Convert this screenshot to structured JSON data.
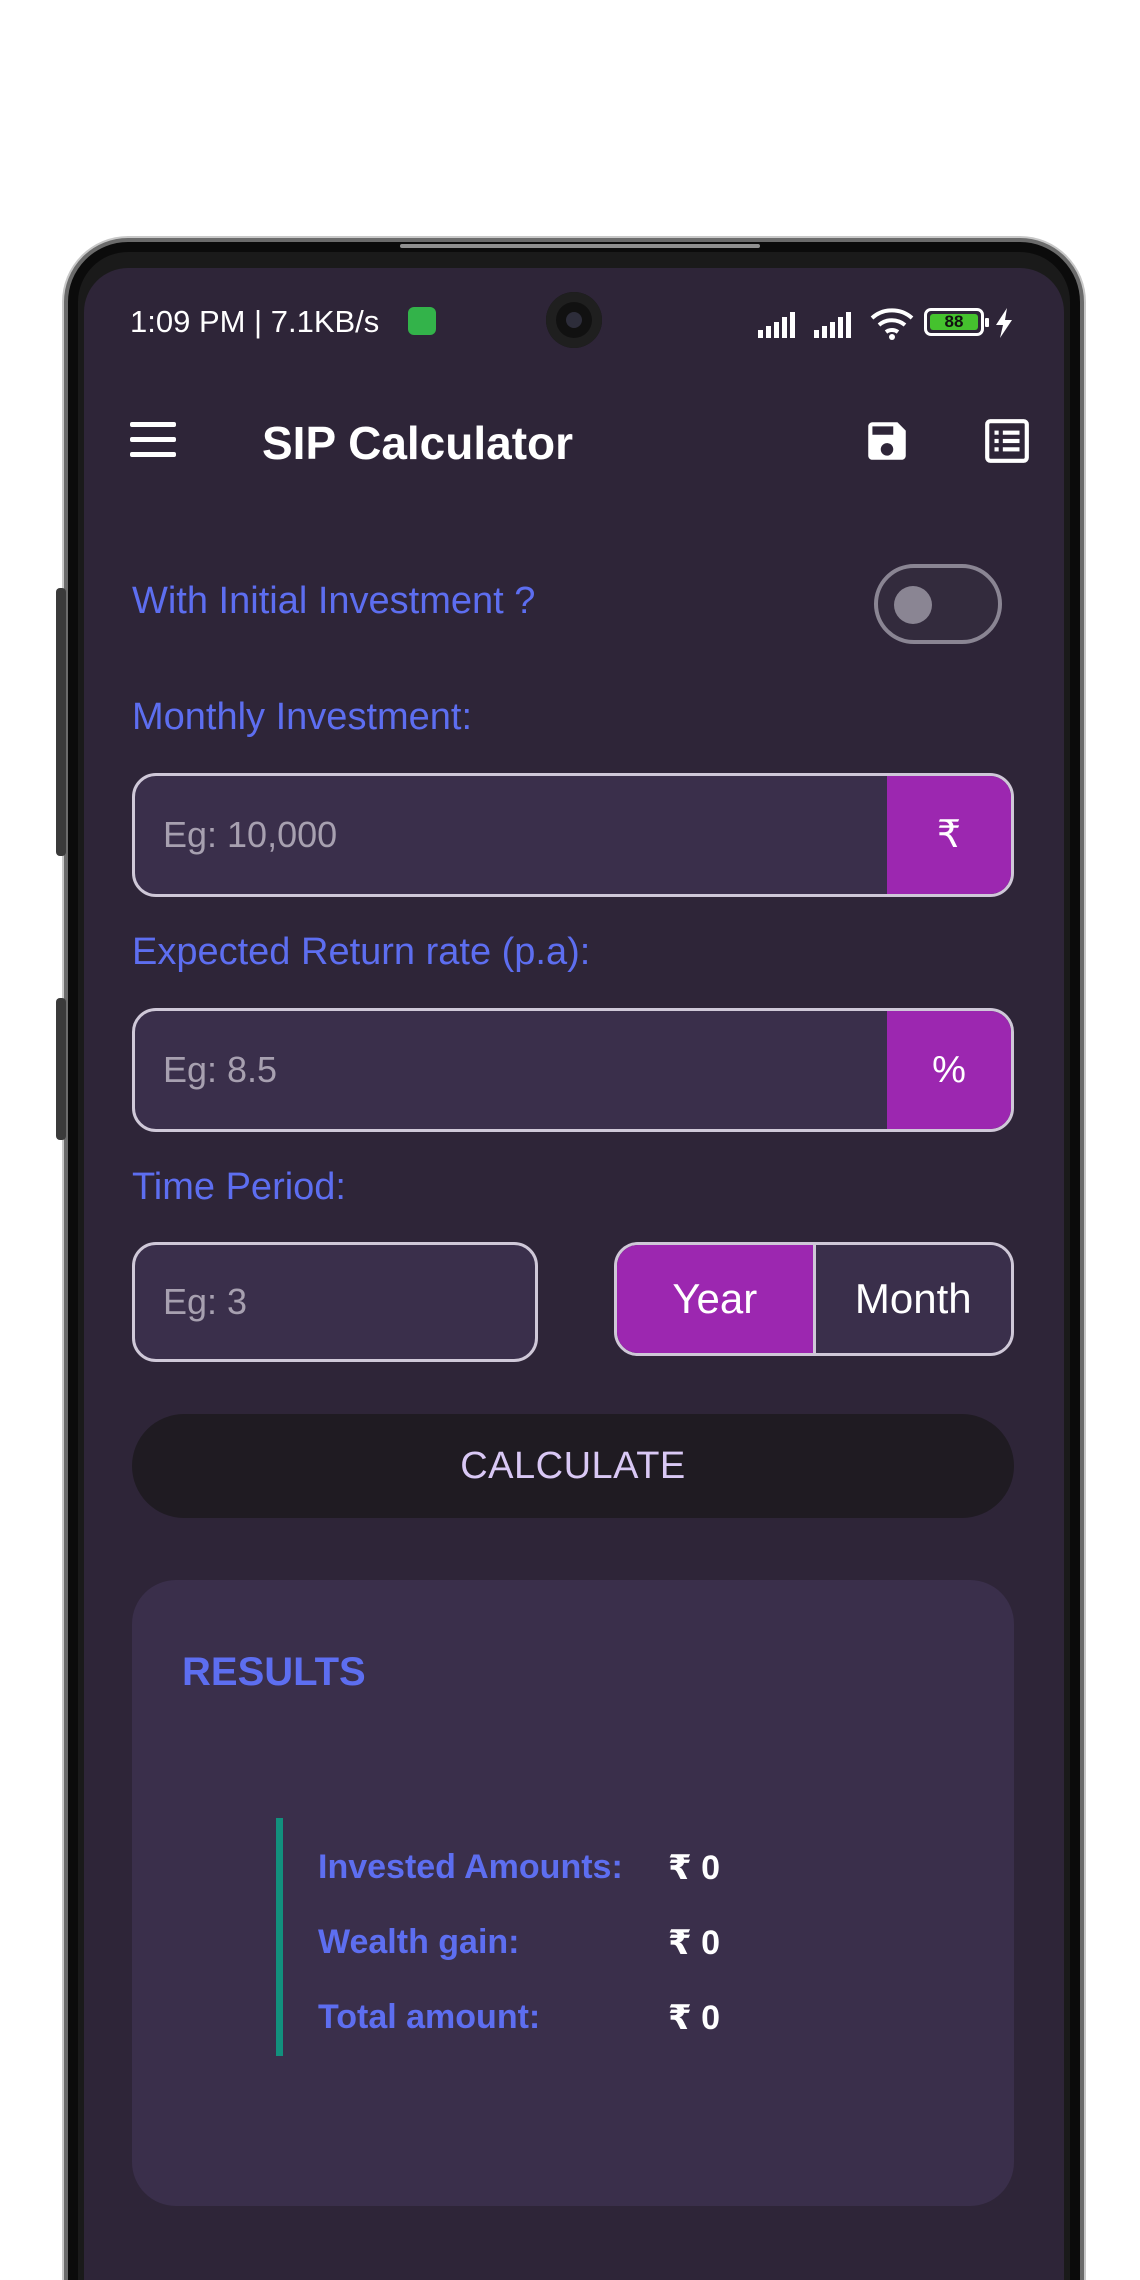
{
  "status_bar": {
    "time": "1:09 PM | 7.1KB/s",
    "battery_level": "88",
    "icons": [
      "app-badge-icon",
      "signal-icon",
      "signal-icon",
      "wifi-icon",
      "battery-icon",
      "charging-icon"
    ]
  },
  "app_bar": {
    "title": "SIP Calculator",
    "icons": [
      "menu-icon",
      "save-icon",
      "list-icon"
    ]
  },
  "form": {
    "initial_investment_label": "With Initial Investment ?",
    "initial_investment_enabled": false,
    "monthly_investment_label": "Monthly Investment:",
    "monthly_investment_placeholder": "Eg: 10,000",
    "monthly_investment_value": "",
    "currency_suffix": "₹",
    "return_rate_label": "Expected Return rate (p.a):",
    "return_rate_placeholder": "Eg: 8.5",
    "return_rate_value": "",
    "percent_suffix": "%",
    "time_period_label": "Time Period:",
    "time_period_placeholder": "Eg: 3",
    "time_period_value": "",
    "period_units": [
      "Year",
      "Month"
    ],
    "selected_period_unit": "Year",
    "calculate_label": "CALCULATE"
  },
  "results": {
    "title": "RESULTS",
    "rows": [
      {
        "label": "Invested Amounts:",
        "value": "₹ 0"
      },
      {
        "label": "Wealth gain:",
        "value": "₹ 0"
      },
      {
        "label": "Total amount:",
        "value": "₹ 0"
      }
    ]
  },
  "colors": {
    "background": "#2e2538",
    "accent_purple": "#9c27b0",
    "label_blue": "#5d6ef0",
    "card": "#3a2f4b",
    "results_bar_green": "#12907d"
  }
}
